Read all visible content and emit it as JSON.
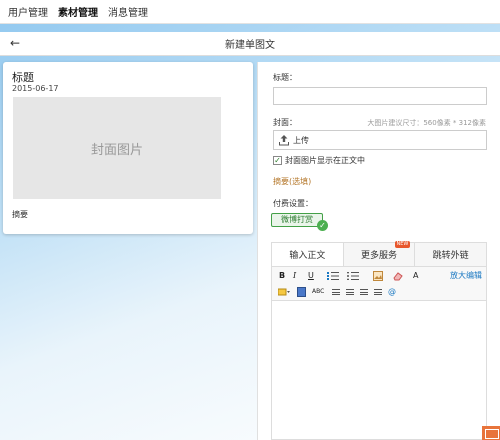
{
  "top_nav": {
    "items": [
      {
        "label": "用户管理"
      },
      {
        "label": "素材管理"
      },
      {
        "label": "消息管理"
      }
    ]
  },
  "subbar": {
    "back_icon": "←",
    "title": "新建单图文"
  },
  "preview": {
    "title": "标题",
    "date": "2015-06-17",
    "cover_text": "封面图片",
    "summary": "摘要"
  },
  "form": {
    "title_label": "标题：",
    "title_value": "",
    "cover_label": "封面：",
    "cover_hint": "大图片建议尺寸：560像素 * 312像素",
    "upload_label": "上传",
    "upload_icon": "upload-icon",
    "show_cover_label": "封面图片显示在正文中",
    "show_cover_checked": true,
    "abstract_link": "摘要(选填)",
    "pay_label": "付费设置：",
    "pay_button": "微博打赏"
  },
  "tabs": [
    {
      "label": "输入正文"
    },
    {
      "label": "更多服务",
      "badge": "NEW"
    },
    {
      "label": "跳转外链"
    }
  ],
  "toolbar": {
    "bold": "B",
    "italic": "I",
    "underline": "U",
    "font_color": "A",
    "abc": "ABC",
    "link": "@",
    "big_edit": "放大编辑"
  },
  "colors": {
    "accent": "#4caf50",
    "link": "#1a78c2",
    "abstract": "#b5782c",
    "mail": "#e8743b"
  }
}
